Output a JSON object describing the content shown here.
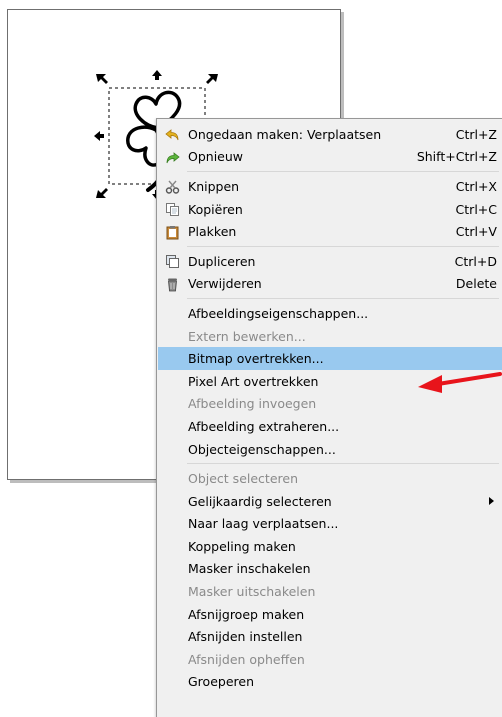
{
  "menu": {
    "items": [
      {
        "label": "Ongedaan maken: Verplaatsen",
        "accel": "Ctrl+Z",
        "icon": "undo-icon"
      },
      {
        "label": "Opnieuw",
        "accel": "Shift+Ctrl+Z",
        "icon": "redo-icon"
      },
      {
        "label": "Knippen",
        "accel": "Ctrl+X",
        "icon": "cut-icon"
      },
      {
        "label": "Kopiëren",
        "accel": "Ctrl+C",
        "icon": "copy-icon"
      },
      {
        "label": "Plakken",
        "accel": "Ctrl+V",
        "icon": "paste-icon"
      },
      {
        "label": "Dupliceren",
        "accel": "Ctrl+D",
        "icon": "duplicate-icon"
      },
      {
        "label": "Verwijderen",
        "accel": "Delete",
        "icon": "delete-icon"
      },
      {
        "label": "Afbeeldingseigenschappen..."
      },
      {
        "label": "Extern bewerken..."
      },
      {
        "label": "Bitmap overtrekken..."
      },
      {
        "label": "Pixel Art overtrekken"
      },
      {
        "label": "Afbeelding invoegen"
      },
      {
        "label": "Afbeelding extraheren..."
      },
      {
        "label": "Objecteigenschappen..."
      },
      {
        "label": "Object selecteren"
      },
      {
        "label": "Gelijkaardig selecteren"
      },
      {
        "label": "Naar laag verplaatsen..."
      },
      {
        "label": "Koppeling maken"
      },
      {
        "label": "Masker inschakelen"
      },
      {
        "label": "Masker uitschakelen"
      },
      {
        "label": "Afsnijgroep maken"
      },
      {
        "label": "Afsnijden instellen"
      },
      {
        "label": "Afsnijden opheffen"
      },
      {
        "label": "Groeperen"
      }
    ]
  },
  "colors": {
    "highlight": "#99c9ef",
    "annotation_arrow": "#e8141b",
    "disabled_text": "#8a8a8a"
  }
}
